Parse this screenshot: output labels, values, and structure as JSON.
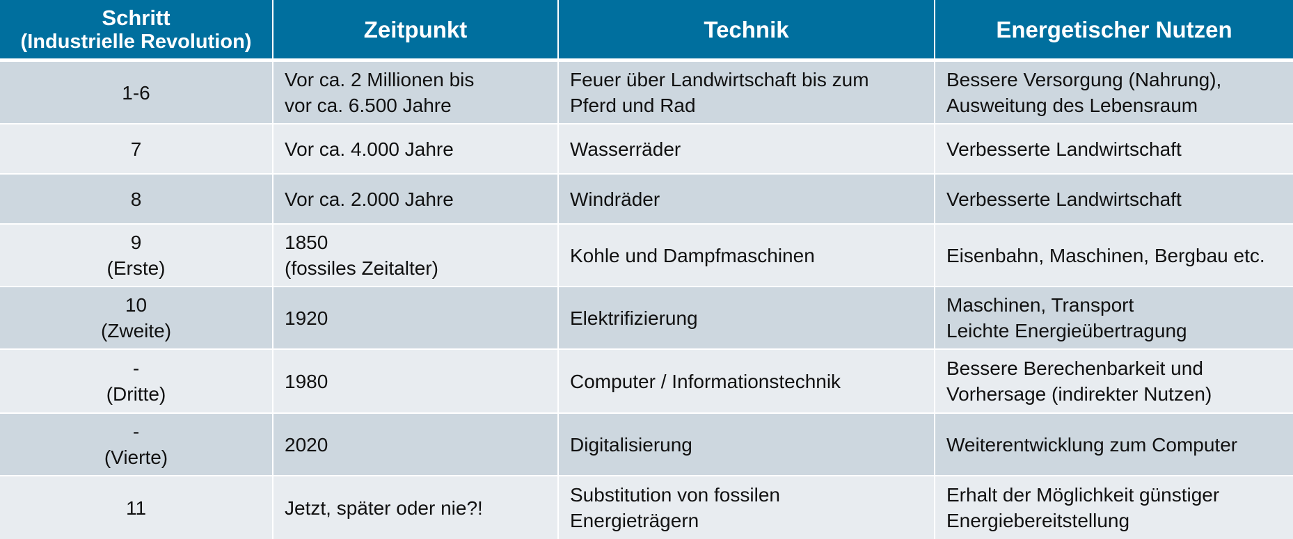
{
  "table": {
    "headers": {
      "step_line1": "Schritt",
      "step_line2": "(Industrielle Revolution)",
      "time": "Zeitpunkt",
      "technique": "Technik",
      "benefit": "Energetischer Nutzen"
    },
    "rows": [
      {
        "step": [
          "1-6",
          ""
        ],
        "time": [
          "Vor ca. 2 Millionen bis",
          "vor ca. 6.500 Jahre"
        ],
        "technique": [
          "Feuer über Landwirtschaft bis zum",
          "Pferd und Rad"
        ],
        "benefit": [
          "Bessere Versorgung (Nahrung),",
          "Ausweitung des Lebensraum"
        ]
      },
      {
        "step": [
          "7",
          ""
        ],
        "time": [
          "Vor ca. 4.000 Jahre",
          ""
        ],
        "technique": [
          "Wasserräder",
          ""
        ],
        "benefit": [
          "Verbesserte Landwirtschaft",
          ""
        ]
      },
      {
        "step": [
          "8",
          ""
        ],
        "time": [
          "Vor ca. 2.000 Jahre",
          ""
        ],
        "technique": [
          "Windräder",
          ""
        ],
        "benefit": [
          "Verbesserte Landwirtschaft",
          ""
        ]
      },
      {
        "step": [
          "9",
          "(Erste)"
        ],
        "time": [
          "1850",
          "(fossiles Zeitalter)"
        ],
        "technique": [
          "Kohle und Dampfmaschinen",
          ""
        ],
        "benefit": [
          "Eisenbahn, Maschinen, Bergbau etc.",
          ""
        ]
      },
      {
        "step": [
          "10",
          "(Zweite)"
        ],
        "time": [
          "1920",
          ""
        ],
        "technique": [
          "Elektrifizierung",
          ""
        ],
        "benefit": [
          "Maschinen, Transport",
          "Leichte Energieübertragung"
        ]
      },
      {
        "step": [
          "-",
          "(Dritte)"
        ],
        "time": [
          "1980",
          ""
        ],
        "technique": [
          "Computer / Informationstechnik",
          ""
        ],
        "benefit": [
          "Bessere Berechenbarkeit und",
          "Vorhersage (indirekter Nutzen)"
        ]
      },
      {
        "step": [
          "-",
          "(Vierte)"
        ],
        "time": [
          "2020",
          ""
        ],
        "technique": [
          "Digitalisierung",
          ""
        ],
        "benefit": [
          "Weiterentwicklung zum Computer",
          ""
        ]
      },
      {
        "step": [
          "11",
          ""
        ],
        "time": [
          "Jetzt, später oder nie?!",
          ""
        ],
        "technique": [
          "Substitution von fossilen",
          "Energieträgern"
        ],
        "benefit": [
          "Erhalt der Möglichkeit günstiger",
          "Energiebereitstellung"
        ]
      }
    ]
  },
  "colors": {
    "header_bg": "#006f9e",
    "row_dark": "#cdd7df",
    "row_light": "#e8ecf0"
  }
}
